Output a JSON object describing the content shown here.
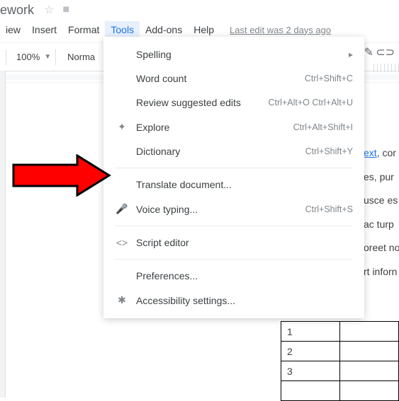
{
  "title": "ework",
  "menubar": {
    "items": [
      "iew",
      "Insert",
      "Format",
      "Tools",
      "Add-ons",
      "Help"
    ],
    "active_index": 3,
    "last_edit": "Last edit was 2 days ago"
  },
  "toolbar": {
    "zoom": "100%",
    "style": "Norma"
  },
  "dropdown": {
    "items": [
      {
        "icon": "",
        "label": "Spelling",
        "shortcut": "",
        "caret": true
      },
      {
        "icon": "",
        "label": "Word count",
        "shortcut": "Ctrl+Shift+C"
      },
      {
        "icon": "",
        "label": "Review suggested edits",
        "shortcut": "Ctrl+Alt+O Ctrl+Alt+U"
      },
      {
        "icon": "✦",
        "label": "Explore",
        "shortcut": "Ctrl+Alt+Shift+I"
      },
      {
        "icon": "",
        "label": "Dictionary",
        "shortcut": "Ctrl+Shift+Y"
      },
      {
        "sep": true
      },
      {
        "icon": "",
        "label": "Translate document..."
      },
      {
        "icon": "🎤",
        "label": "Voice typing...",
        "shortcut": "Ctrl+Shift+S"
      },
      {
        "sep": true
      },
      {
        "icon": "<>",
        "label": "Script editor"
      },
      {
        "sep": true
      },
      {
        "icon": "",
        "label": "Preferences..."
      },
      {
        "icon": "✱",
        "label": "Accessibility settings..."
      }
    ]
  },
  "doc_content": {
    "link_frag": "ext",
    "line1": ", cor",
    "line2": "es, pur",
    "line3": "usce es",
    "line4": "ac turp",
    "line5": "oreet no",
    "line6": "rt inforn"
  },
  "table": {
    "rows": [
      "1",
      "2",
      "3",
      ""
    ]
  }
}
